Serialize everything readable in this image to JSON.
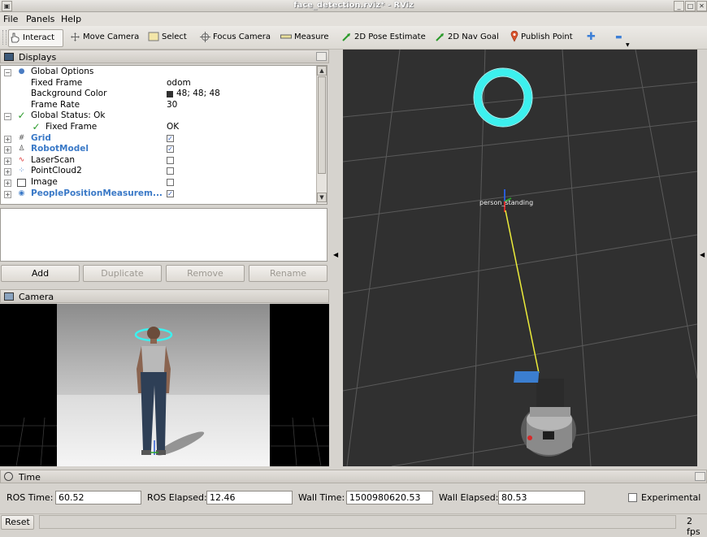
{
  "window": {
    "title": "face_detection.rviz* - RViz"
  },
  "menu": [
    "File",
    "Panels",
    "Help"
  ],
  "toolbar": {
    "tools": [
      {
        "label": "Interact",
        "icon": "hand-pointer-icon"
      },
      {
        "label": "Move Camera",
        "icon": "move-camera-icon"
      },
      {
        "label": "Select",
        "icon": "select-box-icon"
      },
      {
        "label": "Focus Camera",
        "icon": "focus-camera-icon"
      },
      {
        "label": "Measure",
        "icon": "measure-ruler-icon"
      },
      {
        "label": "2D Pose Estimate",
        "icon": "green-arrow-icon"
      },
      {
        "label": "2D Nav Goal",
        "icon": "green-arrow-icon"
      },
      {
        "label": "Publish Point",
        "icon": "map-pin-icon"
      }
    ],
    "add_symbol": "✚",
    "remove_symbol": "▬"
  },
  "displays": {
    "title": "Displays",
    "rows": [
      {
        "label": "Global Options",
        "value": "",
        "kind": "group"
      },
      {
        "label": "Fixed Frame",
        "value": "odom",
        "kind": "prop"
      },
      {
        "label": "Background Color",
        "value": "48; 48; 48",
        "kind": "color"
      },
      {
        "label": "Frame Rate",
        "value": "30",
        "kind": "prop"
      },
      {
        "label": "Global Status: Ok",
        "value": "",
        "kind": "status"
      },
      {
        "label": "Fixed Frame",
        "value": "OK",
        "kind": "substatus"
      },
      {
        "label": "Grid",
        "checked": true,
        "kind": "display",
        "active": true
      },
      {
        "label": "RobotModel",
        "checked": true,
        "kind": "display",
        "active": true
      },
      {
        "label": "LaserScan",
        "checked": false,
        "kind": "display",
        "active": false
      },
      {
        "label": "PointCloud2",
        "checked": false,
        "kind": "display",
        "active": false
      },
      {
        "label": "Image",
        "checked": false,
        "kind": "display",
        "active": false
      },
      {
        "label": "PeoplePositionMeasurem...",
        "checked": true,
        "kind": "display",
        "active": true
      }
    ],
    "buttons": {
      "add": "Add",
      "duplicate": "Duplicate",
      "remove": "Remove",
      "rename": "Rename"
    }
  },
  "camera": {
    "title": "Camera"
  },
  "viewport": {
    "person_label": "person_standing"
  },
  "time": {
    "title": "Time",
    "ros_time_label": "ROS Time:",
    "ros_time": "60.52",
    "ros_elapsed_label": "ROS Elapsed:",
    "ros_elapsed": "12.46",
    "wall_time_label": "Wall Time:",
    "wall_time": "1500980620.53",
    "wall_elapsed_label": "Wall Elapsed:",
    "wall_elapsed": "80.53",
    "experimental_label": "Experimental",
    "experimental": false
  },
  "status": {
    "reset": "Reset",
    "fps": "2 fps"
  },
  "colors": {
    "background": "#303030",
    "ring": "#3cf0ee",
    "grid": "#5a5a5a",
    "link": "#3a79c7"
  }
}
